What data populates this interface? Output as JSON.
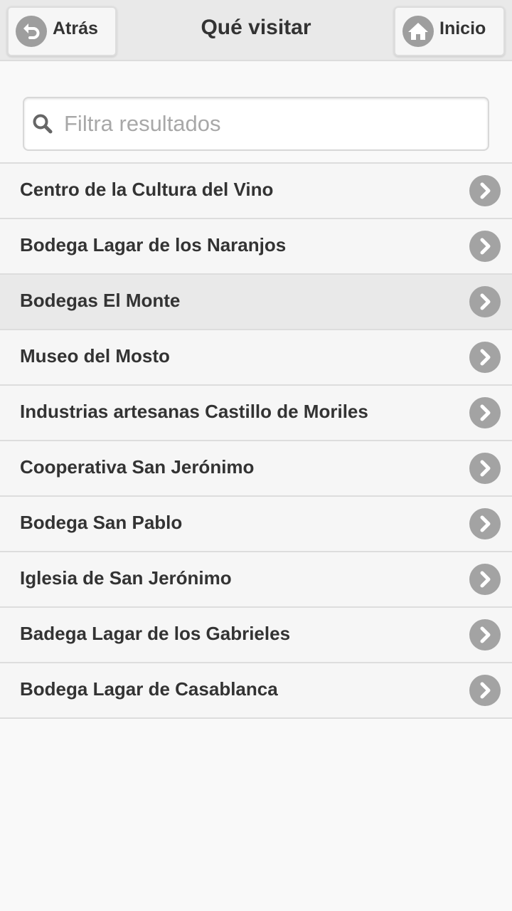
{
  "header": {
    "title": "Qué visitar",
    "back_label": "Atrás",
    "home_label": "Inicio"
  },
  "search": {
    "placeholder": "Filtra resultados",
    "value": ""
  },
  "places": [
    {
      "label": "Centro de la Cultura del Vino"
    },
    {
      "label": "Bodega Lagar de los Naranjos"
    },
    {
      "label": "Bodegas El Monte"
    },
    {
      "label": "Museo del Mosto"
    },
    {
      "label": "Industrias artesanas Castillo de Moriles"
    },
    {
      "label": "Cooperativa San Jerónimo"
    },
    {
      "label": "Bodega San Pablo"
    },
    {
      "label": "Iglesia de San Jerónimo"
    },
    {
      "label": "Badega Lagar de los Gabrieles"
    },
    {
      "label": "Bodega Lagar de Casablanca"
    }
  ],
  "highlighted_item": 2,
  "icons": {
    "back": "undo-arrow-icon",
    "home": "home-icon",
    "search": "search-icon",
    "item_arrow": "chevron-right-icon"
  },
  "colors": {
    "header_bg": "#e9e9e9",
    "list_bg": "#f6f6f6",
    "highlight_bg": "#e9e9e9",
    "icon_circle": "#a3a3a3",
    "text": "#333333",
    "placeholder": "#a8a8a8"
  }
}
